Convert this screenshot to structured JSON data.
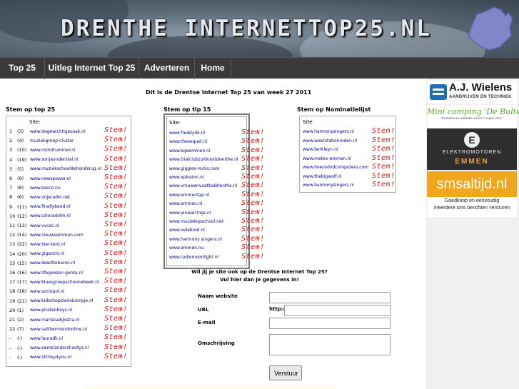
{
  "header": {
    "site_title": "DRENTHE INTERNETTOP25.NL"
  },
  "nav": [
    "Top 25",
    "Uitleg Internet Top 25",
    "Adverteren",
    "Home"
  ],
  "week_line": "Dit is de Drentse Internet Top 25 van week 27 2011",
  "stem_label": "Stem!",
  "top25": {
    "heading": "Stem op top 25",
    "site_header": "Site:",
    "rows": [
      {
        "rank": "1",
        "prev": "(3)",
        "site": "www.degewichtigezaak.nl"
      },
      {
        "rank": "2",
        "prev": "(4)",
        "site": "muziekgroep-cluster"
      },
      {
        "rank": "3",
        "prev": "(10)",
        "site": "www.rockdrummer.nl"
      },
      {
        "rank": "4",
        "prev": "(19)",
        "site": "www.sonjaonderstal.nl"
      },
      {
        "rank": "5",
        "prev": "(5)",
        "site": "www.muziekschooldehondsrug.nl"
      },
      {
        "rank": "6",
        "prev": "(9)",
        "site": "www.newspower.nl"
      },
      {
        "rank": "7",
        "prev": "(8)",
        "site": "www.kasco.nu"
      },
      {
        "rank": "8",
        "prev": "(6)",
        "site": "www.vrijeradio.net"
      },
      {
        "rank": "9",
        "prev": "(11)",
        "site": "www.finallyband.nl"
      },
      {
        "rank": "10",
        "prev": "(12)",
        "site": "www.coloradolm.nl"
      },
      {
        "rank": "11",
        "prev": "(13)",
        "site": "www.vvcec.nl"
      },
      {
        "rank": "12",
        "prev": "(14)",
        "site": "www.nieuwsemmen.com"
      },
      {
        "rank": "13",
        "prev": "(22)",
        "site": "www.bier-tent.nl"
      },
      {
        "rank": "14",
        "prev": "(20)",
        "site": "www.gigantm.nl"
      },
      {
        "rank": "15",
        "prev": "(15)",
        "site": "www.dewittebaron.nl"
      },
      {
        "rank": "16",
        "prev": "(16)",
        "site": "www.lifegoeson-gerda.nl"
      },
      {
        "rank": "17",
        "prev": "(17)",
        "site": "www.bluesgroepschoonebeek.nl"
      },
      {
        "rank": "18",
        "prev": "(18)",
        "site": "www.sociopol.nl"
      },
      {
        "rank": "19",
        "prev": "(21)",
        "site": "www.kidsshopkleinduimpje.nl"
      },
      {
        "rank": "20",
        "prev": "(1)",
        "site": "www.piratenboys.nl"
      },
      {
        "rank": "21",
        "prev": "(2)",
        "site": "www.mariskadijkstra.nl"
      },
      {
        "rank": "22",
        "prev": "(7)",
        "site": "www.valthermondonline.nl"
      },
      {
        "rank": "-",
        "prev": "(-)",
        "site": "www.lauradk.nl"
      },
      {
        "rank": "-",
        "prev": "(-)",
        "site": "www.eemslandershantys.nl"
      },
      {
        "rank": "-",
        "prev": "(-)",
        "site": "www.shirley4you.nl"
      }
    ]
  },
  "tip15": {
    "heading": "Stem op tip 15",
    "site_header": "Site:",
    "rows": [
      "www.freddydk.nl",
      "www.thesequel.nl",
      "www.bgeemmen.nl",
      "www.trialclubzuidoostdrenthe.nl",
      "www.giggles-rocks.com",
      "www.xplosion.nl",
      "www.vrouwenvoetbaldrenthe.nl",
      "www.emmentap.nl",
      "www.emmen.nl",
      "www.jenwarrings.nl",
      "www.muziekopschool.net",
      "www.oelebred.nl",
      "www.harmony singers.nl",
      "www.emmen.nu",
      "www.radiomoonlight.nl"
    ]
  },
  "nominatie": {
    "heading": "Stem op Nominatielijst",
    "site_header": "Site:",
    "rows": [
      "www.harmonysingers.nl",
      "www.weerstationroden.nl",
      "www.berkleyn.nl",
      "www.meteo-emmen.nl",
      "www.hoezodvdcomputers.com",
      "www.thebigwolf.nl",
      "www.harmonysingers.nl"
    ]
  },
  "form": {
    "q1": "Wil jij je site ook op de Drentse Internet Top 25?",
    "q2": "Vul hier dan je gegevens in!",
    "name_label": "Naam website",
    "url_label": "URL",
    "url_prefix": "http://",
    "email_label": "E-mail",
    "desc_label": "Omschrijving",
    "submit": "Verstuur"
  },
  "ads": {
    "wielens_name": "A.J. Wielens",
    "wielens_sub": "AANDRIJVEN EN TECHNIEK",
    "camping_name": "Mini camping 'De Bulte'",
    "camping_sub": "\"Genieten en vakantie vieren in eigen land.\"",
    "motor_icon": "E",
    "motor_l1": "ELEKTROMOTOREN",
    "motor_l2": "EMMEN",
    "sms_name": "smsaltijd.nl",
    "sms_l1": "Goedkoop en eenvoudig",
    "sms_l2": "meerdere sms berichten versturen"
  },
  "colors": {
    "nav_bg": "#3a3a3a",
    "stem_red": "#e01010",
    "link_blue": "#00008b",
    "sms_orange": "#f2a61b"
  }
}
